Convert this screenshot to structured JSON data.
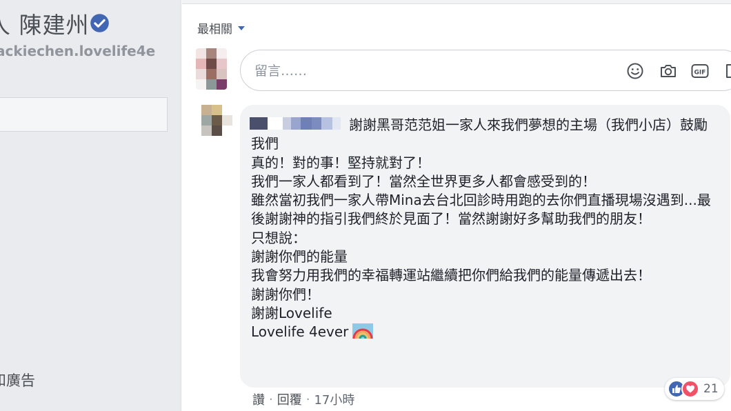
{
  "profile": {
    "name": "人 陳建州",
    "vanity": "ackiechen.lovelife4e",
    "footer_text": "和廣告"
  },
  "comments": {
    "sort_label": "最相關",
    "composer_placeholder": "留言……",
    "composer_icons": [
      "emoji-icon",
      "camera-icon",
      "gif-icon",
      "sticker-icon"
    ],
    "comment": {
      "lines": [
        "謝謝黑哥范范姐一家人來我們夢想的主場（我們小店）鼓勵我們",
        "真的！對的事！堅持就對了！",
        "我們一家人都看到了！當然全世界更多人都會感受到的！",
        "雖然當初我們一家人帶Mina去台北回診時用跑的去你們直播現場沒遇到...最後謝謝神的指引我們終於見面了！當然謝謝好多幫助我們的朋友！",
        "只想說：",
        "謝謝你們的能量",
        "我會努力用我們的幸福轉運站繼續把你們給我們的能量傳遞出去！",
        "謝謝你們！",
        "謝謝Lovelife",
        "Lovelife 4ever"
      ],
      "reaction_count": "21",
      "actions": {
        "like": "讚",
        "reply": "回覆",
        "time": "17小時"
      }
    }
  },
  "colors": {
    "accent": "#4267b2",
    "love": "#f25268",
    "bubble": "#f2f3f5",
    "sidebar": "#e9ebee"
  }
}
